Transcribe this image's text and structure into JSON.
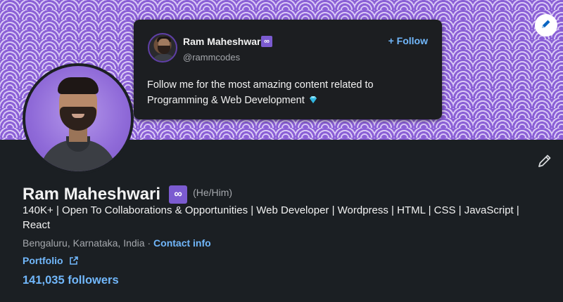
{
  "banner": {
    "edit_icon": "pencil-icon",
    "pattern_colors": [
      "#8a5fd6",
      "#d9c8f5"
    ]
  },
  "card": {
    "name": "Ram Maheshwari",
    "badge": "∞",
    "handle": "@rammcodes",
    "follow_label": "+ Follow",
    "text": "Follow me for the most amazing content related to Programming & Web Development",
    "gem_icon": "diamond-icon"
  },
  "profile": {
    "name": "Ram Maheshwari",
    "badge": "∞",
    "pronouns": "(He/Him)",
    "headline": "140K+ | Open To Collaborations & Opportunities | Web Developer | Wordpress | HTML | CSS | JavaScript | React",
    "location": "Bengaluru, Karnataka, India",
    "separator": " · ",
    "contact_label": "Contact info",
    "portfolio_label": "Portfolio",
    "followers": "141,035 followers",
    "edit_icon": "pencil-icon"
  },
  "colors": {
    "background": "#1b1f23",
    "link": "#71b7fb",
    "badge": "#7b5bd0",
    "text": "#f2f2f2",
    "muted": "#a5a8ad"
  }
}
